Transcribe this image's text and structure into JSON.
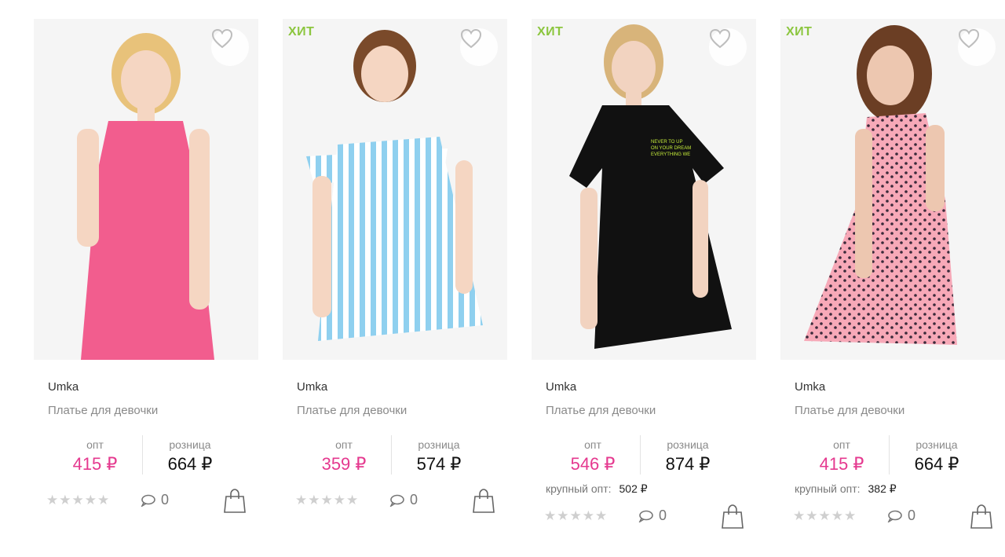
{
  "labels": {
    "opt": "опт",
    "retail": "розница",
    "bulk": "крупный опт:",
    "hit": "ХИТ"
  },
  "icons": {
    "favorite": "heart-icon",
    "comments": "comment-icon",
    "cart": "shopping-bag-icon",
    "rating": "star-icon"
  },
  "colors": {
    "price_opt": "#e5398f",
    "hit_badge": "#8cc63f"
  },
  "products": [
    {
      "brand": "Umka",
      "title": "Платье для девочки",
      "badge": "",
      "opt_price": "415 ₽",
      "retail_price": "664 ₽",
      "bulk_price": "",
      "rating": 0,
      "comments": "0",
      "dress_color": "#f25d8e"
    },
    {
      "brand": "Umka",
      "title": "Платье для девочки",
      "badge": "ХИТ",
      "opt_price": "359 ₽",
      "retail_price": "574 ₽",
      "bulk_price": "",
      "rating": 0,
      "comments": "0",
      "dress_color": "#8fd0ef"
    },
    {
      "brand": "Umka",
      "title": "Платье для девочки",
      "badge": "ХИТ",
      "opt_price": "546 ₽",
      "retail_price": "874 ₽",
      "bulk_price": "502 ₽",
      "rating": 0,
      "comments": "0",
      "dress_color": "#111111"
    },
    {
      "brand": "Umka",
      "title": "Платье для девочки",
      "badge": "ХИТ",
      "opt_price": "415 ₽",
      "retail_price": "664 ₽",
      "bulk_price": "382 ₽",
      "rating": 0,
      "comments": "0",
      "dress_color": "#f7a9b8"
    }
  ]
}
